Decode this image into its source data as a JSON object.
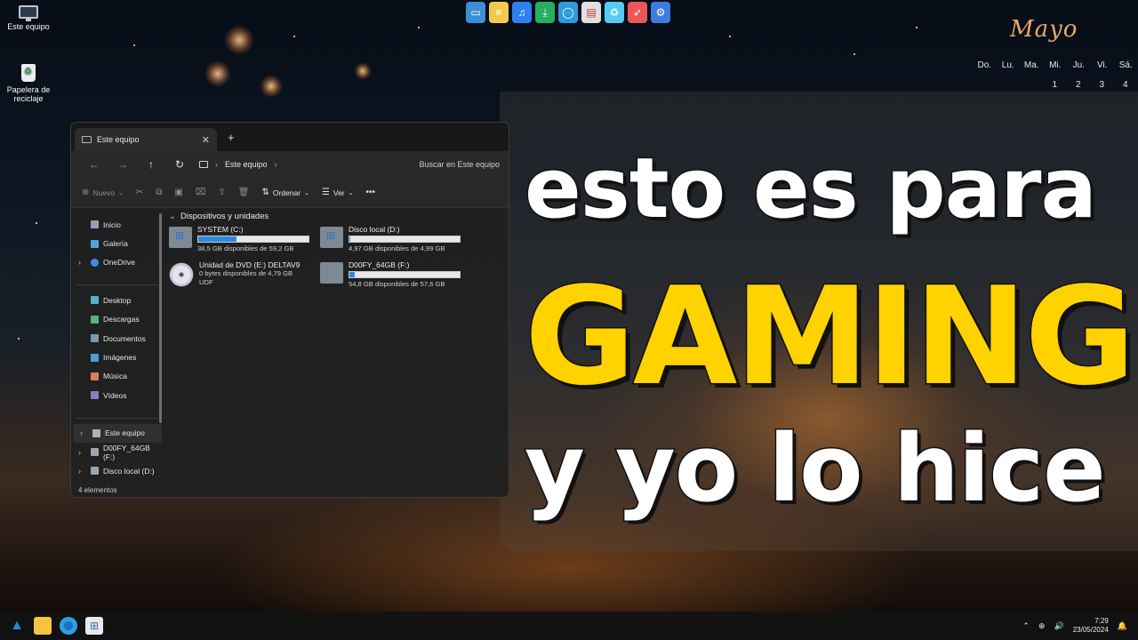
{
  "desktop": {
    "icons": [
      {
        "label": "Este equipo",
        "icon": "monitor-icon"
      },
      {
        "label": "Papelera de\nreciclaje",
        "icon": "recycle-bin-icon"
      }
    ]
  },
  "dock": {
    "apps": [
      {
        "icon": "desktop-monitor-icon",
        "color": "#3b8fd6"
      },
      {
        "icon": "notes-icon",
        "color": "#f2c94c"
      },
      {
        "icon": "music-icon",
        "color": "#2f80ed"
      },
      {
        "icon": "download-icon",
        "color": "#27ae60"
      },
      {
        "icon": "circle-app-icon",
        "color": "#2d9cdb"
      },
      {
        "icon": "cards-icon",
        "color": "#e0e0e0"
      },
      {
        "icon": "recycle-icon",
        "color": "#56ccf2"
      },
      {
        "icon": "rocket-icon",
        "color": "#eb5757"
      },
      {
        "icon": "settings-gear-icon",
        "color": "#3e7be0"
      }
    ]
  },
  "calendar": {
    "month": "Mayo",
    "days": [
      "Do.",
      "Lu.",
      "Ma.",
      "Mi.",
      "Ju.",
      "Vi.",
      "Sá."
    ],
    "dates": [
      "1",
      "2",
      "3",
      "4"
    ]
  },
  "explorer": {
    "tab_title": "Este equipo",
    "path": "Este equipo",
    "search_placeholder": "Buscar en Este equipo",
    "commands": {
      "new": "Nuevo",
      "sort": "Ordenar",
      "view": "Ver"
    },
    "sidebar": {
      "top": [
        {
          "label": "Inicio",
          "icon": "home-icon",
          "color": "#8fa3b8"
        },
        {
          "label": "Galería",
          "icon": "gallery-icon",
          "color": "#4aa3df"
        },
        {
          "label": "OneDrive",
          "icon": "cloud-icon",
          "color": "#3d8ee6",
          "expandable": true
        }
      ],
      "folders": [
        {
          "label": "Desktop",
          "icon": "desktop-folder-icon",
          "color": "#58b0c8"
        },
        {
          "label": "Descargas",
          "icon": "downloads-folder-icon",
          "color": "#59b37b"
        },
        {
          "label": "Documentos",
          "icon": "documents-folder-icon",
          "color": "#7f98b2"
        },
        {
          "label": "Imágenes",
          "icon": "pictures-folder-icon",
          "color": "#4b9ed8"
        },
        {
          "label": "Música",
          "icon": "music-folder-icon",
          "color": "#e07a5f"
        },
        {
          "label": "Vídeos",
          "icon": "videos-folder-icon",
          "color": "#8e7cc3"
        }
      ],
      "devices": [
        {
          "label": "Este equipo",
          "icon": "computer-icon",
          "color": "#a6b4c0"
        },
        {
          "label": "D00FY_64GB (F:)",
          "icon": "usb-drive-icon",
          "color": "#9aa7b2"
        },
        {
          "label": "Disco local (D:)",
          "icon": "disk-icon",
          "color": "#9aa7b2"
        }
      ]
    },
    "group_label": "Dispositivos y unidades",
    "drives": [
      {
        "name": "SYSTEM (C:)",
        "free": "38,5 GB disponibles de 59,2 GB",
        "used_fraction": 0.35,
        "icon": "windows-drive-icon",
        "extra": ""
      },
      {
        "name": "Disco local (D:)",
        "free": "4,97 GB disponibles de 4,99 GB",
        "used_fraction": 0.004,
        "icon": "windows-drive-icon",
        "extra": ""
      },
      {
        "name": "Unidad de DVD (E:) DELTAV9",
        "free": "0 bytes disponibles de 4,79 GB",
        "used_fraction": null,
        "icon": "dvd-disc-icon",
        "extra": "UDF"
      },
      {
        "name": "D00FY_64GB (F:)",
        "free": "54,8 GB disponibles de 57,6 GB",
        "used_fraction": 0.05,
        "icon": "usb-drive-icon",
        "extra": ""
      }
    ],
    "status": "4 elementos"
  },
  "headline": {
    "line1": "esto es para",
    "line2": "GAMING",
    "line3": "y yo lo hice"
  },
  "taskbar": {
    "apps": [
      {
        "icon": "arch-logo-icon",
        "color": "#1793d1"
      },
      {
        "icon": "file-explorer-icon",
        "color": "#f4c542"
      },
      {
        "icon": "edge-browser-icon",
        "color": "#2aa0e0"
      },
      {
        "icon": "store-icon",
        "color": "#e8e8e8"
      }
    ],
    "time": "7:29",
    "date": "23/05/2024"
  }
}
